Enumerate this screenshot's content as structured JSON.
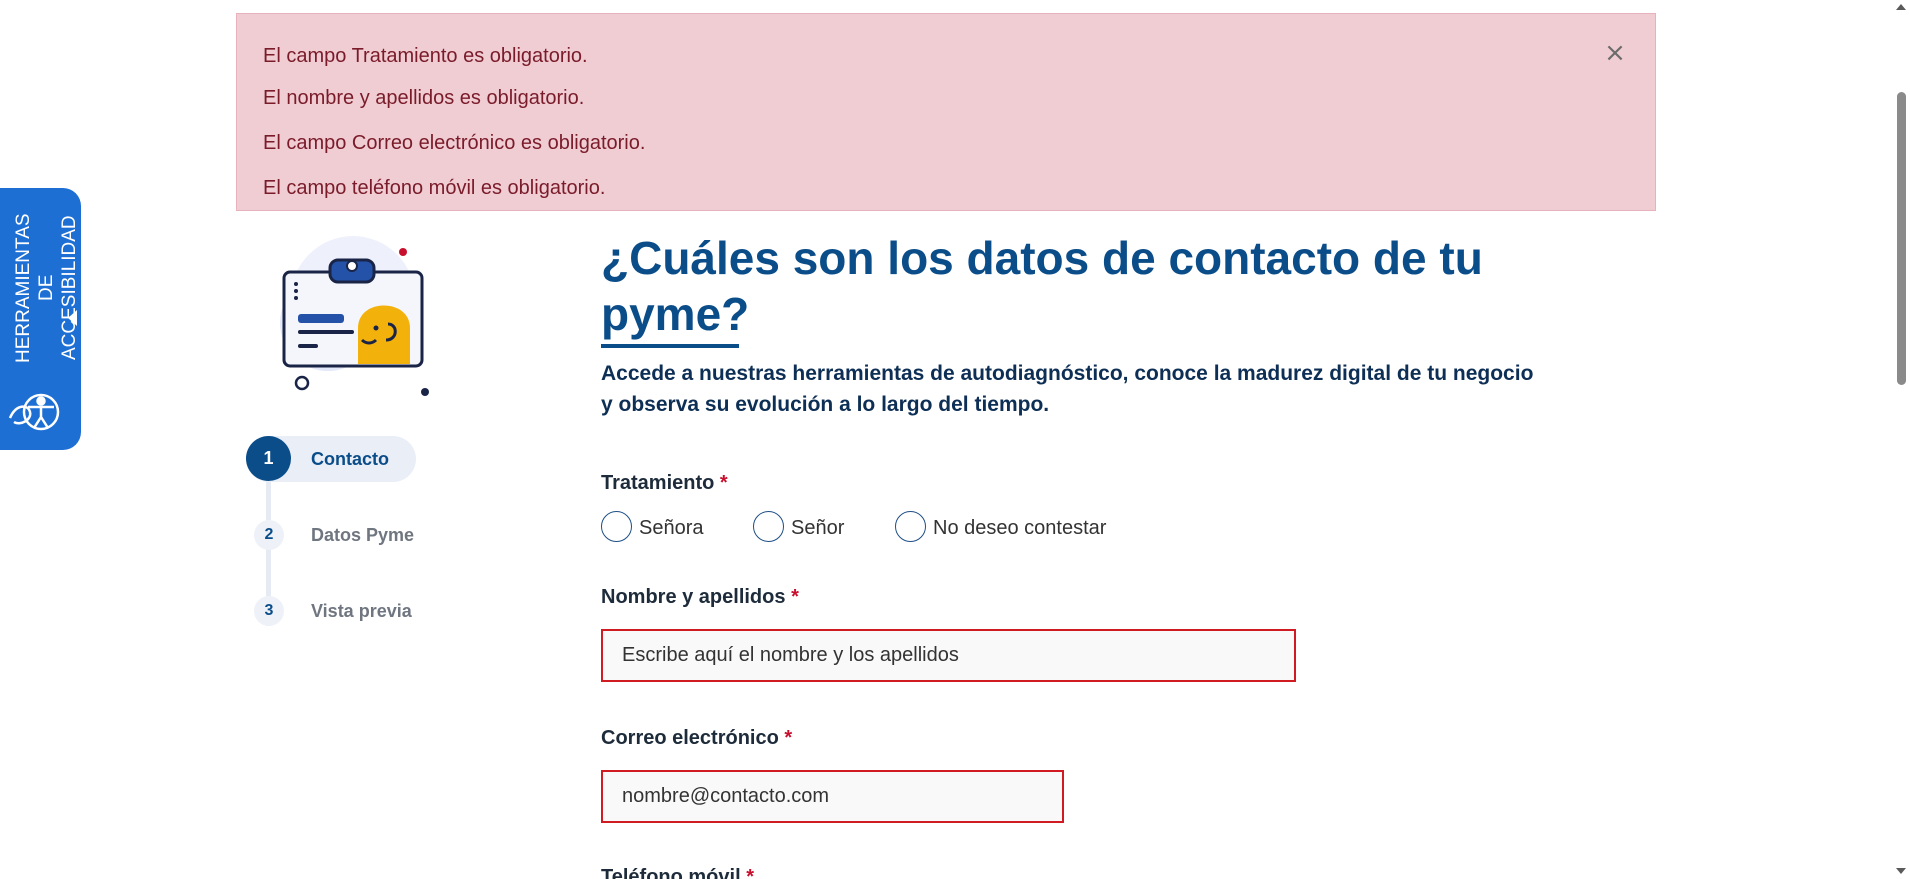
{
  "alert": {
    "messages": [
      "El campo Tratamiento es obligatorio.",
      "El nombre y apellidos es obligatorio.",
      "El campo Correo electrónico es obligatorio.",
      "El campo teléfono móvil es obligatorio."
    ],
    "close_symbol": "×"
  },
  "accessibility": {
    "label_line1": "Herramientas de",
    "label_line2": "accesibilidad",
    "icon": "accessibility-icon"
  },
  "steps": [
    {
      "number": "1",
      "label": "Contacto",
      "active": true
    },
    {
      "number": "2",
      "label": "Datos Pyme",
      "active": false
    },
    {
      "number": "3",
      "label": "Vista previa",
      "active": false
    }
  ],
  "main": {
    "title": "¿Cuáles son los datos de contacto de tu pyme?",
    "subtitle": "Accede a nuestras herramientas de autodiagnóstico, conoce la madurez digital de tu negocio y observa su evolución a lo largo del tiempo."
  },
  "form": {
    "required_mark": "*",
    "tratamiento": {
      "label": "Tratamiento",
      "options": [
        "Señora",
        "Señor",
        "No deseo contestar"
      ]
    },
    "nombre": {
      "label": "Nombre y apellidos",
      "placeholder": "Escribe aquí el nombre y los apellidos"
    },
    "correo": {
      "label": "Correo electrónico",
      "placeholder": "nombre@contacto.com"
    },
    "telefono": {
      "label": "Teléfono móvil"
    }
  },
  "colors": {
    "brand_blue": "#0b4d89",
    "accessibility_blue": "#1e6fd4",
    "error_red": "#d11b22",
    "alert_bg": "#f0cdd3"
  }
}
